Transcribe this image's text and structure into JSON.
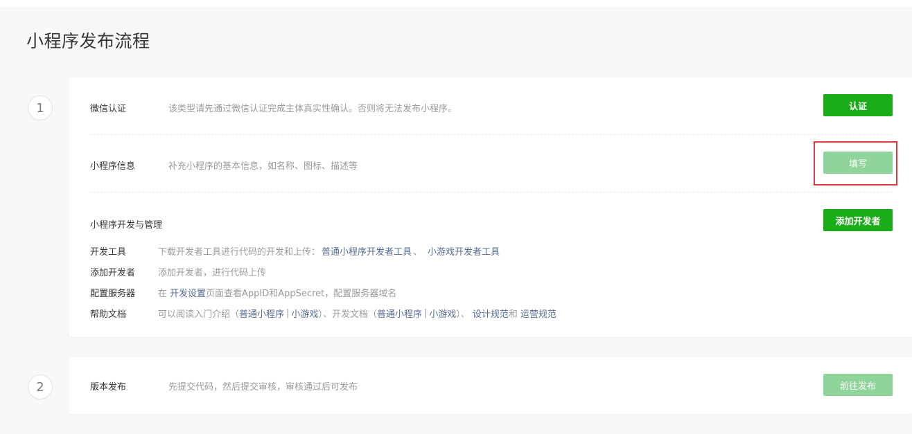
{
  "page": {
    "title": "小程序发布流程"
  },
  "step1": {
    "number": "1",
    "wechat_verify": {
      "label": "微信认证",
      "desc": "该类型请先通过微信认证完成主体真实性确认。否则将无法发布小程序。",
      "button": "认证"
    },
    "app_info": {
      "label": "小程序信息",
      "desc": "补充小程序的基本信息，如名称、图标、描述等",
      "button": "填写"
    },
    "dev_manage": {
      "title": "小程序开发与管理",
      "button": "添加开发者",
      "dev_tools": {
        "label": "开发工具",
        "desc": "下载开发者工具进行代码的开发和上传：",
        "link1": "普通小程序开发者工具",
        "sep": "、",
        "link2": "小游戏开发者工具"
      },
      "add_dev": {
        "label": "添加开发者",
        "desc": "添加开发者，进行代码上传"
      },
      "server_config": {
        "label": "配置服务器",
        "prefix": "在",
        "link": "开发设置",
        "suffix": "页面查看AppID和AppSecret，配置服务器域名"
      },
      "help_docs": {
        "label": "帮助文档",
        "t1": "可以阅读入门介绍（",
        "l1": "普通小程序",
        "bar1": "|",
        "l2": "小游戏",
        "t2": "）、开发文档（",
        "l3": "普通小程序",
        "bar2": "|",
        "l4": "小游戏",
        "t3": "）、",
        "l5": "设计规范",
        "t4": "和",
        "l6": "运营规范"
      }
    }
  },
  "step2": {
    "number": "2",
    "label": "版本发布",
    "desc": "先提交代码，然后提交审核，审核通过后可发布",
    "button": "前往发布"
  },
  "colors": {
    "primary": "#1aad19",
    "disabled": "#8fd49a",
    "link": "#576b95",
    "highlight": "#e3393c"
  }
}
